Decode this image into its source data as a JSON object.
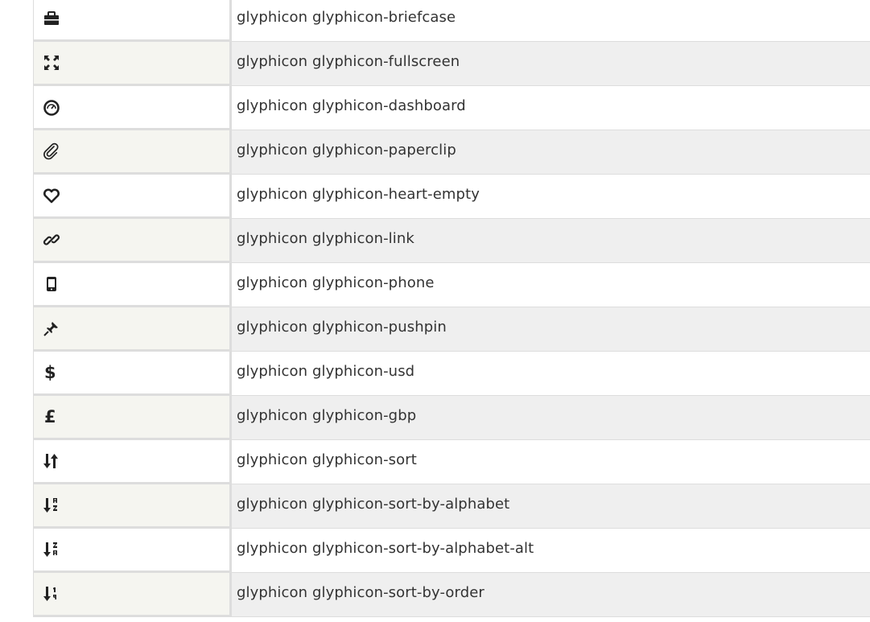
{
  "rows": [
    {
      "icon": "briefcase-icon",
      "name": "glyphicon glyphicon-briefcase"
    },
    {
      "icon": "fullscreen-icon",
      "name": "glyphicon glyphicon-fullscreen"
    },
    {
      "icon": "dashboard-icon",
      "name": "glyphicon glyphicon-dashboard"
    },
    {
      "icon": "paperclip-icon",
      "name": "glyphicon glyphicon-paperclip"
    },
    {
      "icon": "heart-empty-icon",
      "name": "glyphicon glyphicon-heart-empty"
    },
    {
      "icon": "link-icon",
      "name": "glyphicon glyphicon-link"
    },
    {
      "icon": "phone-icon",
      "name": "glyphicon glyphicon-phone"
    },
    {
      "icon": "pushpin-icon",
      "name": "glyphicon glyphicon-pushpin"
    },
    {
      "icon": "usd-icon",
      "name": "glyphicon glyphicon-usd",
      "glyph_text": "$"
    },
    {
      "icon": "gbp-icon",
      "name": "glyphicon glyphicon-gbp",
      "glyph_text": "£"
    },
    {
      "icon": "sort-icon",
      "name": "glyphicon glyphicon-sort"
    },
    {
      "icon": "sort-by-alphabet-icon",
      "name": "glyphicon glyphicon-sort-by-alphabet"
    },
    {
      "icon": "sort-by-alphabet-alt-icon",
      "name": "glyphicon glyphicon-sort-by-alphabet-alt"
    },
    {
      "icon": "sort-by-order-icon",
      "name": "glyphicon glyphicon-sort-by-order"
    }
  ],
  "colors": {
    "row_alt_bg": "#efefef",
    "icon_alt_bg": "#f5f5f0",
    "border": "#dddddd",
    "text": "#333333"
  }
}
